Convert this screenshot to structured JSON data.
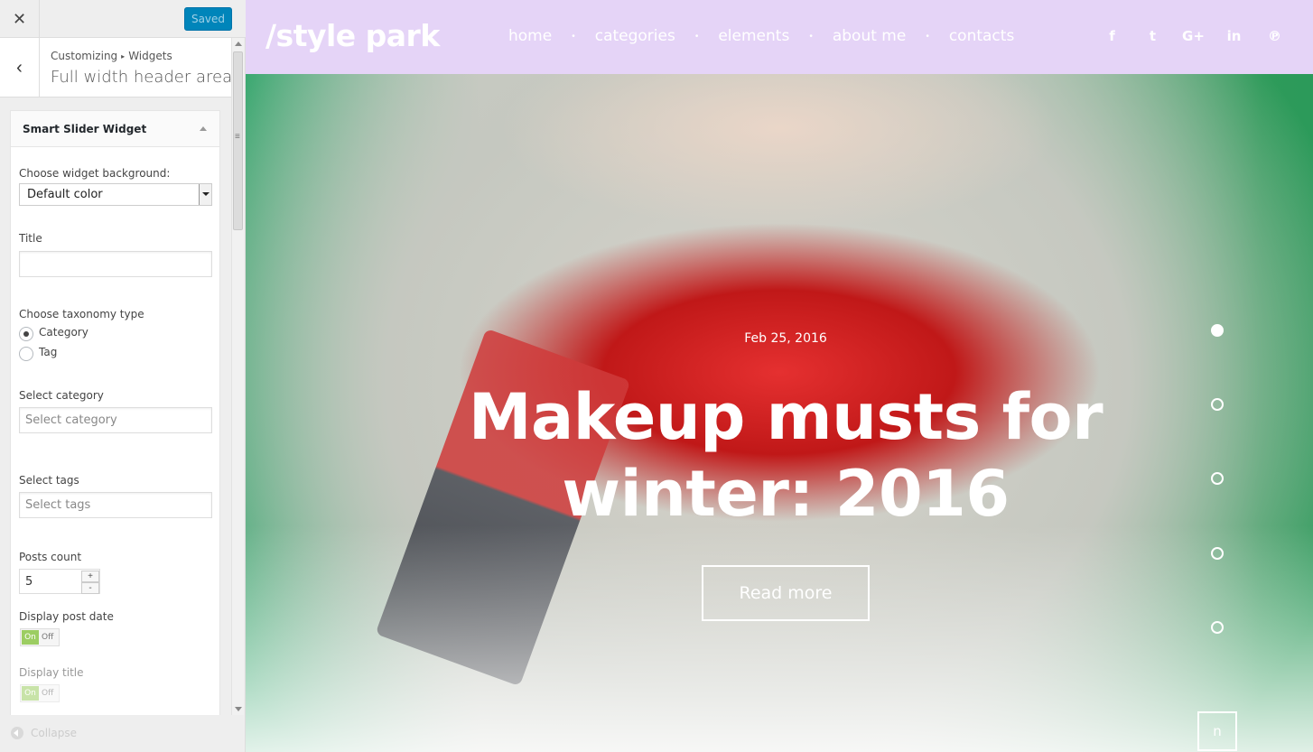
{
  "customizer": {
    "close_icon": "✕",
    "save_label": "Saved",
    "back_icon": "‹",
    "breadcrumb": [
      "Customizing",
      "Widgets"
    ],
    "breadcrumb_separator": "▸",
    "section_title": "Full width header area",
    "collapse_label": "Collapse"
  },
  "widget": {
    "name": "Smart Slider Widget",
    "background_label": "Choose widget background:",
    "background_value": "Default color",
    "title_label": "Title",
    "title_value": "",
    "taxonomy_label": "Choose taxonomy type",
    "taxonomy_options": [
      {
        "label": "Category",
        "selected": true
      },
      {
        "label": "Tag",
        "selected": false
      }
    ],
    "category_label": "Select category",
    "category_placeholder": "Select category",
    "tags_label": "Select tags",
    "tags_placeholder": "Select tags",
    "posts_count_label": "Posts count",
    "posts_count_value": "5",
    "stepper_up": "+",
    "stepper_down": "-",
    "display_date_label": "Display post date",
    "display_title_label": "Display title",
    "switch_on": "On",
    "switch_off": "Off"
  },
  "site": {
    "logo": "/style park",
    "nav": [
      "home",
      "categories",
      "elements",
      "about me",
      "contacts"
    ],
    "nav_separator": "•",
    "social_icons": [
      {
        "name": "facebook-icon",
        "glyph": "f"
      },
      {
        "name": "twitter-icon",
        "glyph": "t"
      },
      {
        "name": "google-plus-icon",
        "glyph": "G+"
      },
      {
        "name": "linkedin-icon",
        "glyph": "in"
      },
      {
        "name": "pinterest-icon",
        "glyph": "℗"
      }
    ],
    "header_color": "#e5d4f7",
    "slide": {
      "date": "Feb 25, 2016",
      "title_line1": "Makeup musts for",
      "title_line2": "winter: 2016",
      "button": "Read more",
      "pager_count": 5,
      "active_index": 0,
      "corner_button": "n"
    }
  }
}
